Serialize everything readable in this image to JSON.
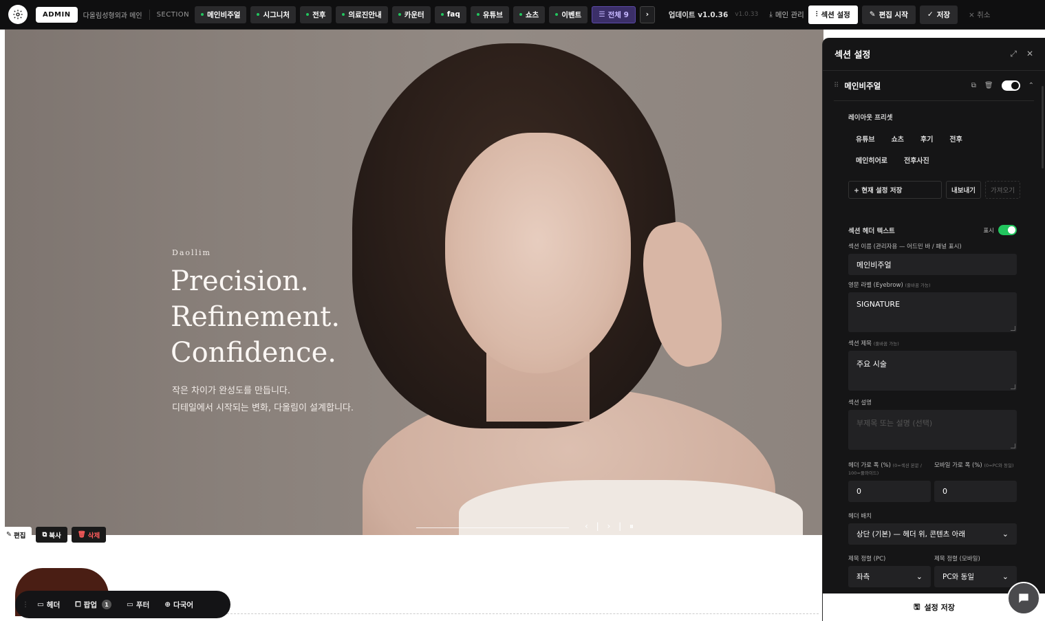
{
  "adminbar": {
    "badge": "ADMIN",
    "site_name": "다올림성형외과 메인",
    "section_label": "SECTION",
    "sections": [
      "메인비주얼",
      "시그니처",
      "전후",
      "의료진안내",
      "카운터",
      "faq",
      "유튜브",
      "쇼츠",
      "이벤트"
    ],
    "all_label": "전체 9",
    "update_label": "업데이트 v1.0.36",
    "version_small": "v1.0.33",
    "main_manage": "메인 관리",
    "section_settings": "섹션 설정",
    "edit_start": "편집 시작",
    "save": "저장",
    "cancel": "취소"
  },
  "hero": {
    "brand": "Daollim",
    "headline_1": "Precision.",
    "headline_2": "Refinement.",
    "headline_3": "Confidence.",
    "sub_1": "작은 차이가 완성도를 만듭니다.",
    "sub_2": "디테일에서 시작되는 변화, 다올림이 설계합니다.",
    "slider_controls": "‹ | › | ⏸"
  },
  "edit_chips": {
    "edit": "편집",
    "copy": "복사",
    "delete": "삭제"
  },
  "dock": {
    "header": "헤더",
    "popup": "팝업",
    "popup_count": "1",
    "footer": "푸터",
    "language": "다국어"
  },
  "panel": {
    "title": "섹션 설정",
    "section_name": "메인비주얼",
    "preset_label": "레이아웃 프리셋",
    "presets": [
      "유튜브",
      "쇼츠",
      "후기",
      "전후",
      "메인히어로",
      "전후사진"
    ],
    "save_current": "+ 현재 설정 저장",
    "export": "내보내기",
    "import": "가져오기",
    "header_text_label": "섹션 헤더 텍스트",
    "show_label": "표시",
    "name_label": "섹션 이름 (관리자용 — 어드민 바 / 패널 표시)",
    "name_value": "메인비주얼",
    "eyebrow_label": "영문 라벨 (Eyebrow)",
    "eyebrow_hint": "(줄바꿈 가능)",
    "eyebrow_value": "SIGNATURE",
    "title_label": "섹션 제목",
    "title_hint": "(줄바꿈 가능)",
    "title_value": "주요 시술",
    "desc_label": "섹션 설명",
    "desc_placeholder": "부제목 또는 설명 (선택)",
    "hw_label": "헤더 가로 폭 (%)",
    "hw_hint": "(0=섹션 본문 / 100=풀와이드)",
    "mw_label": "모바일 가로 폭 (%)",
    "mw_hint": "(0=PC와 동일)",
    "hw_value": "0",
    "mw_value": "0",
    "placement_label": "헤더 배치",
    "placement_value": "상단 (기본) — 헤더 위, 콘텐츠 아래",
    "align_pc_label": "제목 정렬 (PC)",
    "align_mobile_label": "제목 정렬 (모바일)",
    "align_pc_value": "좌측",
    "align_mobile_value": "PC와 동일",
    "save_settings": "설정 저장"
  },
  "colors": {
    "active_dot": "#22c55e",
    "panel_bg": "#151516",
    "accent_purple": "#3b2f68"
  }
}
